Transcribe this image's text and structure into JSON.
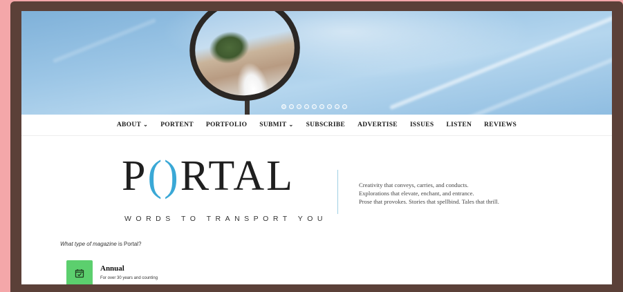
{
  "hero": {
    "slide_count": 9,
    "active_slide": 0
  },
  "nav": {
    "items": [
      {
        "label": "ABOUT",
        "has_dropdown": true
      },
      {
        "label": "PORTENT",
        "has_dropdown": false
      },
      {
        "label": "PORTFOLIO",
        "has_dropdown": false
      },
      {
        "label": "SUBMIT",
        "has_dropdown": true
      },
      {
        "label": "SUBSCRIBE",
        "has_dropdown": false
      },
      {
        "label": "ADVERTISE",
        "has_dropdown": false
      },
      {
        "label": "ISSUES",
        "has_dropdown": false
      },
      {
        "label": "LISTEN",
        "has_dropdown": false
      },
      {
        "label": "REVIEWS",
        "has_dropdown": false
      }
    ]
  },
  "logo": {
    "letter_p": "P",
    "paren_open": "(",
    "paren_close": ")",
    "rest": "RTAL",
    "tagline": "WORDS TO TRANSPORT YOU",
    "accent_color": "#3aa8d6"
  },
  "blurb": {
    "line1": "Creativity that conveys, carries, and conducts.",
    "line2": "Explorations that elevate, enchant, and entrance.",
    "line3": "Prose that provokes. Stories that spellbind. Tales that thrill."
  },
  "question": {
    "italic": "What type of magazine",
    "rest": " is Portal?"
  },
  "card": {
    "icon": "calendar-check-icon",
    "icon_bg": "#5ccf6e",
    "title": "Annual",
    "subtitle": "For over 30 years and counting"
  }
}
